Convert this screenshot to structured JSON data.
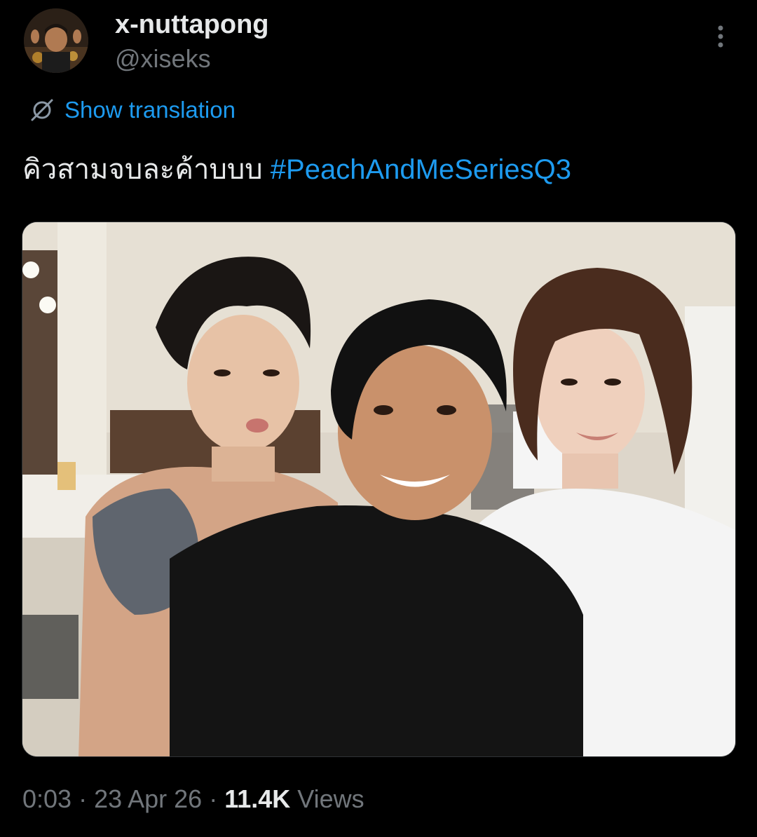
{
  "author": {
    "display_name": "x-nuttapong",
    "handle": "@xiseks"
  },
  "icons": {
    "more": "more-vertical-icon",
    "translate": "globe-translate-icon"
  },
  "translation": {
    "label": "Show translation"
  },
  "tweet": {
    "text": "คิวสามจบละค้าบบบ ",
    "hashtag": "#PeachAndMeSeriesQ3"
  },
  "meta": {
    "time": "0:03",
    "separator1": " · ",
    "date": "23 Apr 26",
    "separator2": " · ",
    "views_count": "11.4K",
    "views_label": " Views"
  },
  "colors": {
    "background": "#000000",
    "primary_text": "#e7e9ea",
    "secondary_text": "#71767b",
    "accent": "#1d9bf0"
  }
}
